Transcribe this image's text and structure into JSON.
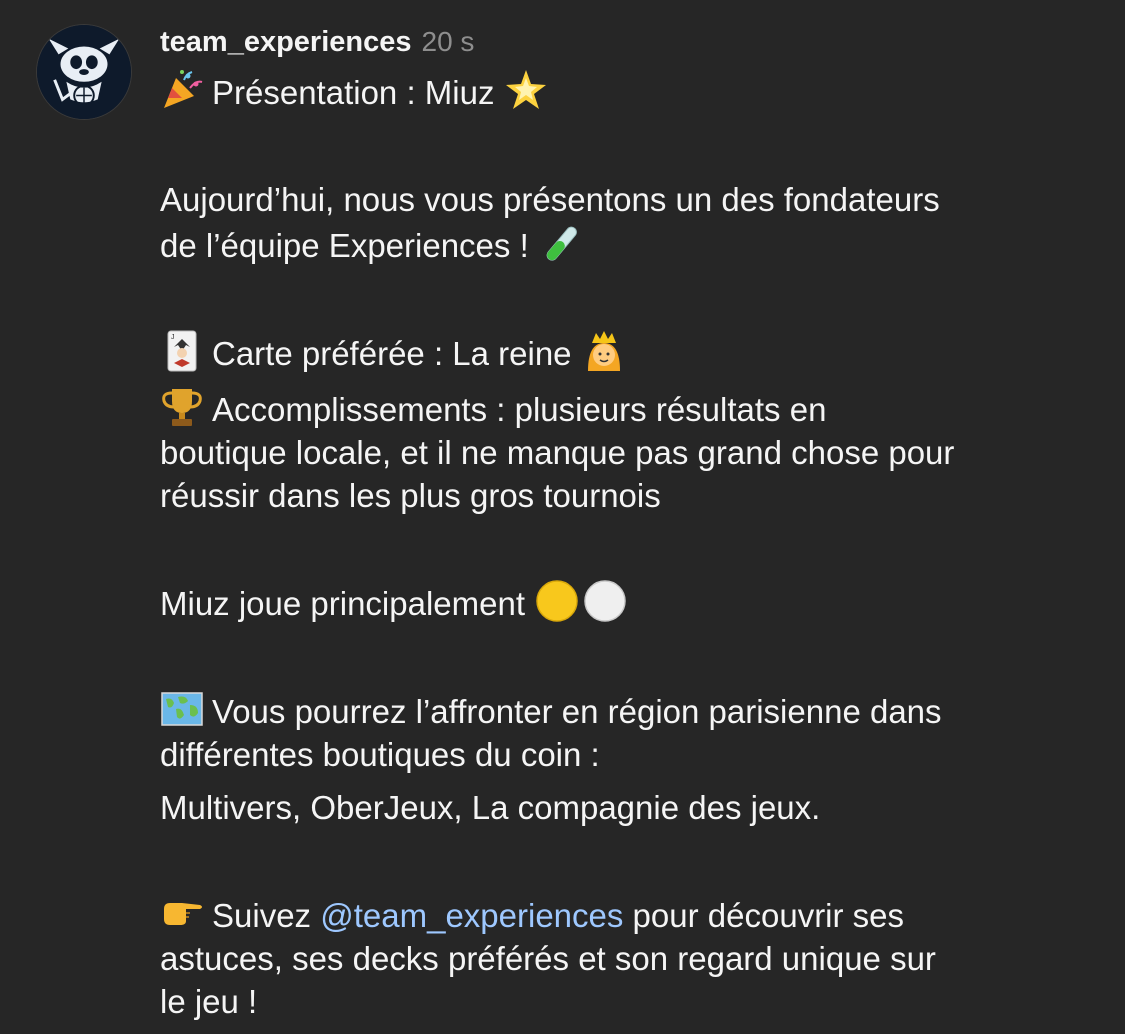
{
  "post": {
    "username": "team_experiences",
    "timestamp": "20 s",
    "avatar_icon": "stitch-avatar-icon",
    "title": "Présentation : Miuz",
    "intro_line1": "Aujourd’hui, nous vous présentons un des fondateurs",
    "intro_line2": "de l’équipe Experiences !",
    "favorite_card": "Carte préférée : La reine",
    "achievements_line1": "Accomplissements : plusieurs résultats en",
    "achievements_line2": "boutique locale, et il ne manque pas grand chose pour",
    "achievements_line3": "réussir dans les plus gros tournois",
    "plays": "Miuz joue principalement",
    "location_line1": "Vous pourrez l’affronter en région parisienne dans",
    "location_line2": "différentes boutiques du coin :",
    "shops": "Multivers, OberJeux, La compagnie des jeux.",
    "follow_prefix": "Suivez",
    "follow_mention": "@team_experiences",
    "follow_suffix": " pour découvrir ses",
    "follow_line2": "astuces, ses decks préférés et son regard unique sur",
    "follow_line3": "le jeu !"
  },
  "emojis": {
    "party": "party-popper-icon",
    "star": "glowing-star-icon",
    "test_tube": "test-tube-icon",
    "joker": "joker-card-icon",
    "queen": "princess-icon",
    "trophy": "trophy-icon",
    "yellow_circle": "yellow-circle-icon",
    "white_circle": "white-circle-icon",
    "map": "world-map-icon",
    "pointing": "pointing-right-icon"
  },
  "colors": {
    "background": "#262626",
    "text": "#f5f5f5",
    "muted": "#8e8e8e",
    "mention": "#9ec8ff"
  }
}
